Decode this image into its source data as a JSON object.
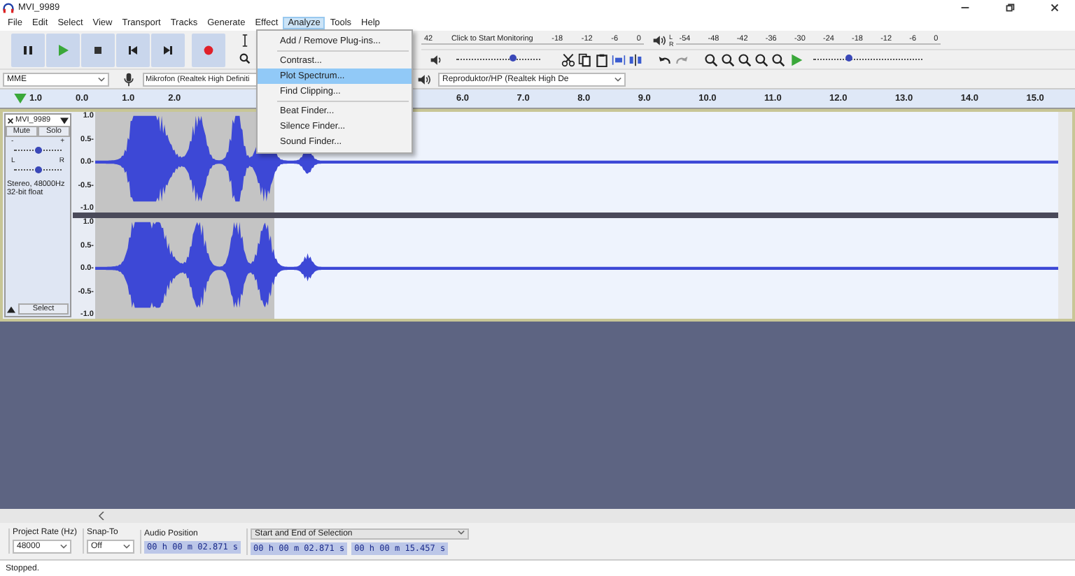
{
  "window": {
    "title": "MVI_9989"
  },
  "menubar": [
    {
      "label": "File",
      "selected": false
    },
    {
      "label": "Edit",
      "selected": false
    },
    {
      "label": "Select",
      "selected": false
    },
    {
      "label": "View",
      "selected": false
    },
    {
      "label": "Transport",
      "selected": false
    },
    {
      "label": "Tracks",
      "selected": false
    },
    {
      "label": "Generate",
      "selected": false
    },
    {
      "label": "Effect",
      "selected": false
    },
    {
      "label": "Analyze",
      "selected": true
    },
    {
      "label": "Tools",
      "selected": false
    },
    {
      "label": "Help",
      "selected": false
    }
  ],
  "analyze_menu": [
    {
      "items": [
        {
          "label": "Add / Remove Plug-ins...",
          "selected": false
        }
      ]
    },
    {
      "items": [
        {
          "label": "Contrast...",
          "selected": false
        },
        {
          "label": "Plot Spectrum...",
          "selected": true
        },
        {
          "label": "Find Clipping...",
          "selected": false
        }
      ]
    },
    {
      "items": [
        {
          "label": "Beat Finder...",
          "selected": false
        },
        {
          "label": "Silence Finder...",
          "selected": false
        },
        {
          "label": "Sound Finder...",
          "selected": false
        }
      ]
    }
  ],
  "recording_meter": {
    "ticks": [
      "42",
      "Click to Start Monitoring",
      "-18",
      "-12",
      "-6",
      "0"
    ]
  },
  "playback_meter": {
    "channels": [
      "L",
      "R"
    ],
    "ticks": [
      "-54",
      "-48",
      "-42",
      "-36",
      "-30",
      "-24",
      "-18",
      "-12",
      "-6",
      "0"
    ]
  },
  "recording_volume": {
    "level": 0.68
  },
  "play_at_speed": {
    "level": 0.33
  },
  "devices": {
    "host": "MME",
    "recording": "Mikrofon (Realtek High Definiti",
    "playback": "Reproduktor/HP (Realtek High De"
  },
  "ruler": {
    "left_ticks": [
      "1.0",
      "0.0",
      "1.0",
      "2.0"
    ],
    "right_ticks": [
      "6.0",
      "7.0",
      "8.0",
      "9.0",
      "10.0",
      "11.0",
      "12.0",
      "13.0",
      "14.0",
      "15.0"
    ]
  },
  "track": {
    "name": "MVI_9989",
    "mute": "Mute",
    "solo": "Solo",
    "gain": {
      "minus": "-",
      "plus": "+",
      "level": 0.5
    },
    "pan": {
      "left": "L",
      "right": "R",
      "level": 0.5
    },
    "info": [
      "Stereo, 48000Hz",
      "32-bit float"
    ],
    "select": "Select",
    "channels": [
      {
        "scale": [
          "1.0",
          "0.5-",
          "0.0-",
          "-0.5-",
          "-1.0"
        ]
      },
      {
        "scale": [
          "1.0",
          "0.5-",
          "0.0-",
          "-0.5-",
          "-1.0"
        ]
      }
    ]
  },
  "selection_bar": {
    "project_rate_label": "Project Rate (Hz)",
    "project_rate": "48000",
    "snap_to_label": "Snap-To",
    "snap_to": "Off",
    "audio_position_label": "Audio Position",
    "audio_position": "00 h 00 m 02.871 s",
    "selection_label": "Start and End of Selection",
    "selection_start": "00 h 00 m 02.871 s",
    "selection_end": "00 h 00 m 15.457 s"
  },
  "status_bar": {
    "text": "Stopped."
  }
}
